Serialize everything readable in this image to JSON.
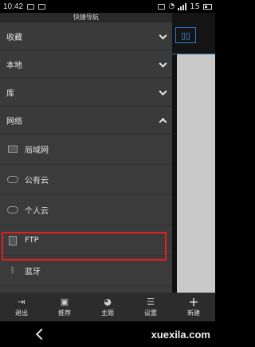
{
  "status_bar": {
    "time": "10:42",
    "battery": "15"
  },
  "drawer": {
    "title": "快捷导航",
    "sections": [
      {
        "label": "收藏",
        "expanded": false
      },
      {
        "label": "本地",
        "expanded": false
      },
      {
        "label": "库",
        "expanded": false
      },
      {
        "label": "网络",
        "expanded": true
      }
    ],
    "network_items": [
      {
        "label": "局域网",
        "icon": "lan-icon"
      },
      {
        "label": "公有云",
        "icon": "cloud-icon"
      },
      {
        "label": "个人云",
        "icon": "cloud-icon"
      },
      {
        "label": "FTP",
        "icon": "ftp-icon",
        "highlighted": true
      },
      {
        "label": "蓝牙",
        "icon": "bluetooth-icon"
      }
    ]
  },
  "toolbar": {
    "items": [
      {
        "label": "退出",
        "icon": "exit-icon"
      },
      {
        "label": "推荐",
        "icon": "gift-icon"
      },
      {
        "label": "主题",
        "icon": "palette-icon"
      },
      {
        "label": "设置",
        "icon": "sliders-icon"
      },
      {
        "label": "新建",
        "icon": "plus-icon"
      }
    ]
  },
  "watermark": "xuexila.com",
  "colors": {
    "highlight_border": "#e02020",
    "accent": "#2e79c7"
  }
}
